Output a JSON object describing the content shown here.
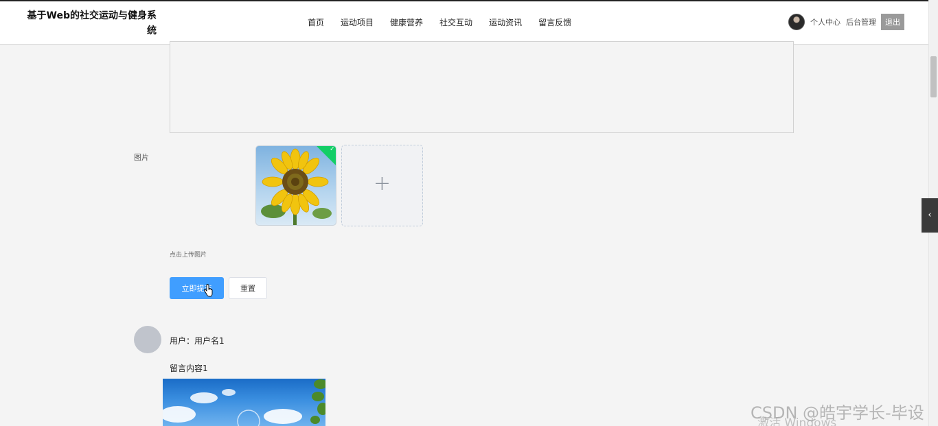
{
  "header": {
    "title": "基于Web的社交运动与健身系统",
    "nav": [
      "首页",
      "运动项目",
      "健康营养",
      "社交互动",
      "运动资讯",
      "留言反馈"
    ],
    "active_nav": "留言反馈",
    "personal_center": "个人中心",
    "admin": "后台管理",
    "logout": "退出"
  },
  "form": {
    "image_label": "图片",
    "upload_tip": "点击上传图片",
    "upload_add": "+",
    "submit": "立即提交",
    "reset": "重置"
  },
  "comment": {
    "user": "用户：用户名1",
    "content": "留言内容1"
  },
  "watermark": {
    "csdn": "CSDN @皓宇学长-毕设",
    "windows": "激活 Windows"
  },
  "colors": {
    "accent": "#409eff",
    "nav_active": "#c81a1a",
    "upload_success": "#13ce66"
  }
}
